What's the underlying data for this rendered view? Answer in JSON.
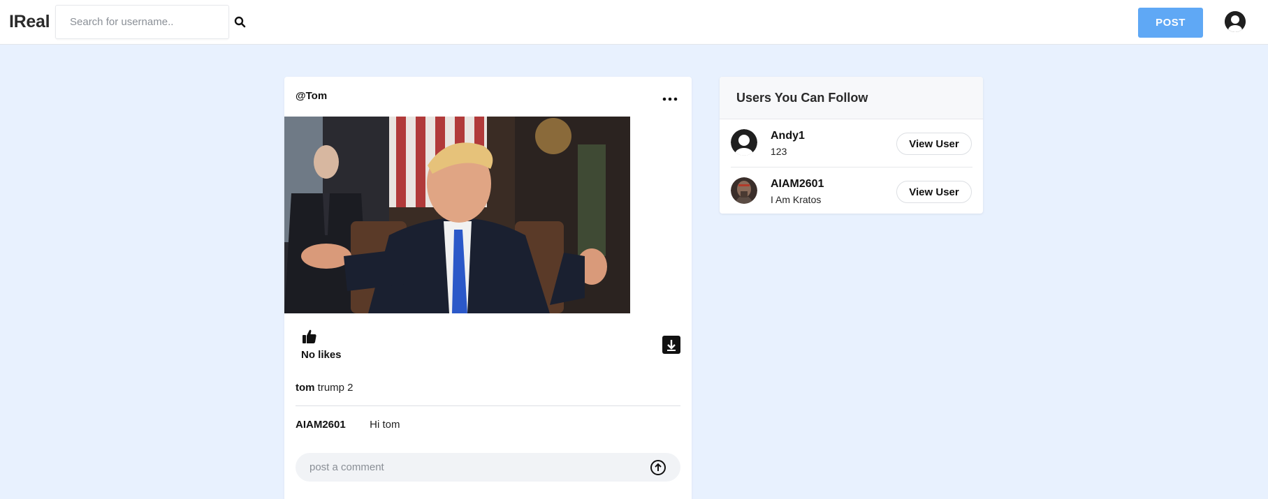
{
  "app": {
    "logo": "IReal"
  },
  "header": {
    "search_placeholder": "Search for username..",
    "post_label": "POST",
    "accent": "#5fa8f5",
    "background": "#e8f1fe"
  },
  "post": {
    "author": "@Tom",
    "likes_text": "No likes",
    "caption_user": "tom",
    "caption_text": "trump 2",
    "comments": [
      {
        "user": "AIAM2601",
        "text": "Hi tom"
      }
    ],
    "comment_placeholder": "post a comment",
    "icons": [
      "more-horizontal-icon",
      "thumbs-up-icon",
      "download-icon",
      "arrow-up-circle-icon"
    ]
  },
  "suggestions": {
    "title": "Users You Can Follow",
    "users": [
      {
        "name": "Andy1",
        "bio": "123",
        "button_label": "View User",
        "avatar": "default-avatar-icon"
      },
      {
        "name": "AIAM2601",
        "bio": "I Am Kratos",
        "button_label": "View User",
        "avatar": "kratos-avatar"
      }
    ]
  }
}
